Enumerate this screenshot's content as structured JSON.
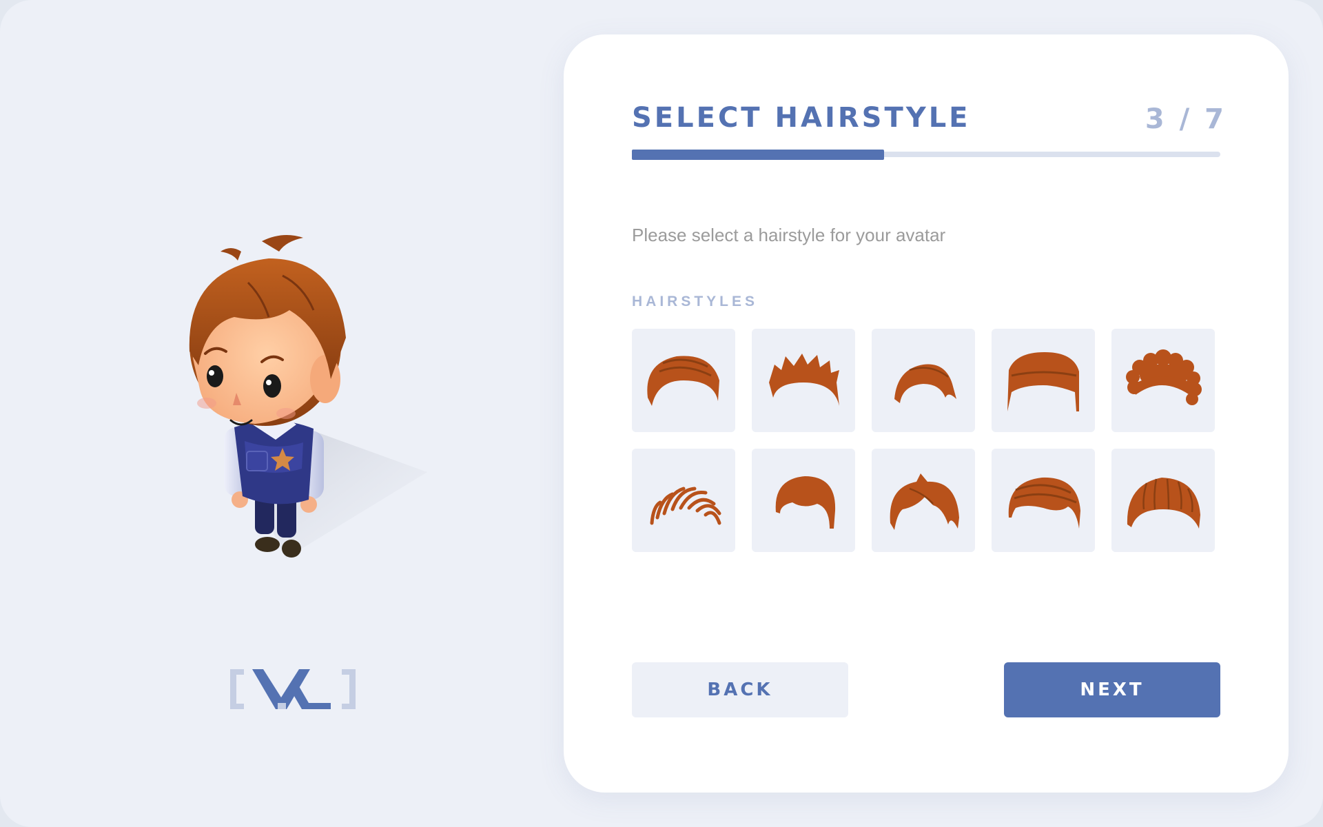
{
  "wizard": {
    "title": "SELECT HAIRSTYLE",
    "step_counter": "3 / 7",
    "current_step": 3,
    "total_steps": 7,
    "progress_fraction": 0.4286,
    "instructions": "Please select a hairstyle for your avatar",
    "section_label": "HAIRSTYLES",
    "back_label": "BACK",
    "next_label": "NEXT"
  },
  "hairstyles": [
    {
      "name": "hairstyle-quiff-icon"
    },
    {
      "name": "hairstyle-spiky-icon"
    },
    {
      "name": "hairstyle-side-swept-icon"
    },
    {
      "name": "hairstyle-bowl-cut-icon"
    },
    {
      "name": "hairstyle-curly-icon"
    },
    {
      "name": "hairstyle-comb-over-icon"
    },
    {
      "name": "hairstyle-bob-icon"
    },
    {
      "name": "hairstyle-tousled-icon"
    },
    {
      "name": "hairstyle-pompadour-icon"
    },
    {
      "name": "hairstyle-ridged-icon"
    }
  ],
  "colors": {
    "accent": "#5472b2",
    "accent_light": "#a9b7d6",
    "tile_background": "#edf0f7",
    "hair": "#b8521b",
    "muted_text": "#9b9b9b"
  },
  "avatar": {
    "icon": "avatar-character-illustration"
  },
  "logo": {
    "icon": "brand-logo"
  }
}
